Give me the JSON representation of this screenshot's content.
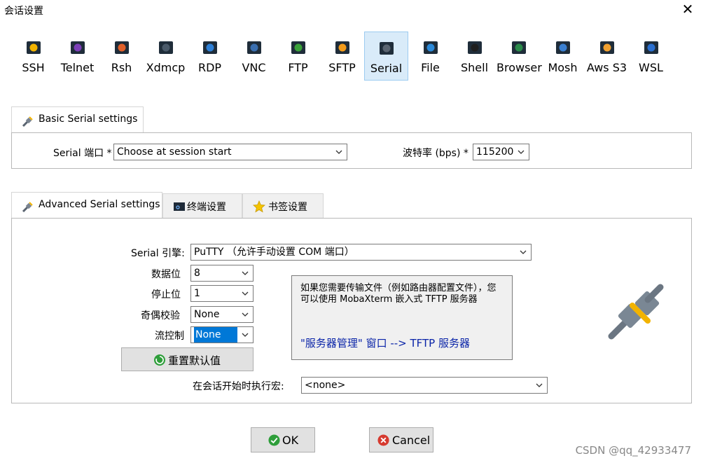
{
  "window": {
    "title": "会话设置"
  },
  "session_types": [
    {
      "label": "SSH",
      "icon": "ssh-icon"
    },
    {
      "label": "Telnet",
      "icon": "telnet-icon"
    },
    {
      "label": "Rsh",
      "icon": "rsh-icon"
    },
    {
      "label": "Xdmcp",
      "icon": "xdmcp-icon"
    },
    {
      "label": "RDP",
      "icon": "rdp-icon"
    },
    {
      "label": "VNC",
      "icon": "vnc-icon"
    },
    {
      "label": "FTP",
      "icon": "ftp-icon"
    },
    {
      "label": "SFTP",
      "icon": "sftp-icon"
    },
    {
      "label": "Serial",
      "icon": "serial-icon",
      "active": true
    },
    {
      "label": "File",
      "icon": "file-icon"
    },
    {
      "label": "Shell",
      "icon": "shell-icon"
    },
    {
      "label": "Browser",
      "icon": "browser-icon"
    },
    {
      "label": "Mosh",
      "icon": "mosh-icon"
    },
    {
      "label": "Aws S3",
      "icon": "aws-s3-icon"
    },
    {
      "label": "WSL",
      "icon": "wsl-icon"
    }
  ],
  "basic": {
    "tab_label": "Basic Serial settings",
    "port_label": "Serial 端口 *",
    "port_value": "Choose at session start",
    "baud_label": "波特率 (bps) *",
    "baud_value": "115200"
  },
  "advanced": {
    "tabs": [
      "Advanced Serial settings",
      "终端设置",
      "书签设置"
    ],
    "engine_label": "Serial 引擎:",
    "engine_value": "PuTTY  （允许手动设置 COM 端口）",
    "data_bits_label": "数据位",
    "data_bits_value": "8",
    "stop_bits_label": "停止位",
    "stop_bits_value": "1",
    "parity_label": "奇偶校验",
    "parity_value": "None",
    "flow_label": "流控制",
    "flow_value": "None",
    "reset_label": "重置默认值",
    "macro_label": "在会话开始时执行宏:",
    "macro_value": "<none>",
    "info_text": "如果您需要传输文件（例如路由器配置文件），您可以使用 MobaXterm 嵌入式 TFTP 服务器",
    "info_link": "\"服务器管理\" 窗口  -->  TFTP 服务器"
  },
  "footer": {
    "ok_label": "OK",
    "cancel_label": "Cancel"
  },
  "watermark": "CSDN @qq_42933477",
  "colors": {
    "active_tab_bg": "#d9ebf9",
    "link": "#0a24a8",
    "ok_green": "#2e9e3a",
    "cancel_red": "#d63a2f"
  }
}
